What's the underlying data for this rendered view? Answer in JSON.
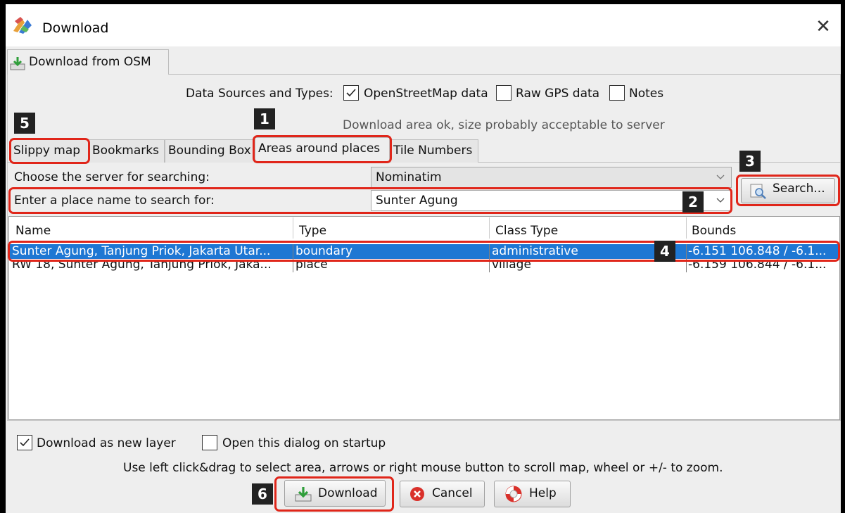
{
  "window": {
    "title": "Download",
    "close_glyph": "✕"
  },
  "outer_tab": {
    "label": "Download from OSM"
  },
  "data_sources": {
    "label": "Data Sources and Types:",
    "options": [
      {
        "label": "OpenStreetMap data",
        "checked": true
      },
      {
        "label": "Raw GPS data",
        "checked": false
      },
      {
        "label": "Notes",
        "checked": false
      }
    ]
  },
  "size_message": "Download area ok, size probably acceptable to server",
  "inner_tabs": [
    {
      "label": "Slippy map",
      "active": false
    },
    {
      "label": "Bookmarks",
      "active": false
    },
    {
      "label": "Bounding Box",
      "active": false
    },
    {
      "label": "Areas around places",
      "active": true
    },
    {
      "label": "Tile Numbers",
      "active": false
    }
  ],
  "server_row": {
    "label": "Choose the server for searching:",
    "value": "Nominatim"
  },
  "place_row": {
    "label": "Enter a place name to search for:",
    "value": "Sunter Agung"
  },
  "search_button": {
    "label": "Search..."
  },
  "results_table": {
    "columns": [
      "Name",
      "Type",
      "Class Type",
      "Bounds"
    ],
    "rows": [
      {
        "name": "Sunter Agung, Tanjung Priok, Jakarta Utar...",
        "type": "boundary",
        "class_type": "administrative",
        "bounds": "-6.151 106.848 / -6.1...",
        "selected": true
      },
      {
        "name": "RW 18, Sunter Agung, Tanjung Priok, Jaka...",
        "type": "place",
        "class_type": "village",
        "bounds": "-6.159 106.844 / -6.1...",
        "selected": false
      }
    ]
  },
  "bottom_options": [
    {
      "label": "Download as new layer",
      "checked": true
    },
    {
      "label": "Open this dialog on startup",
      "checked": false
    }
  ],
  "hint": "Use left click&drag to select area, arrows or right mouse button to scroll map, wheel or +/- to zoom.",
  "buttons": {
    "download": "Download",
    "cancel": "Cancel",
    "help": "Help"
  },
  "annotations": {
    "badges": [
      "1",
      "2",
      "3",
      "4",
      "5",
      "6"
    ],
    "highlight_color": "#e0261a"
  },
  "colors": {
    "selection": "#1e77d3",
    "dialog_bg": "#eeeeee"
  }
}
